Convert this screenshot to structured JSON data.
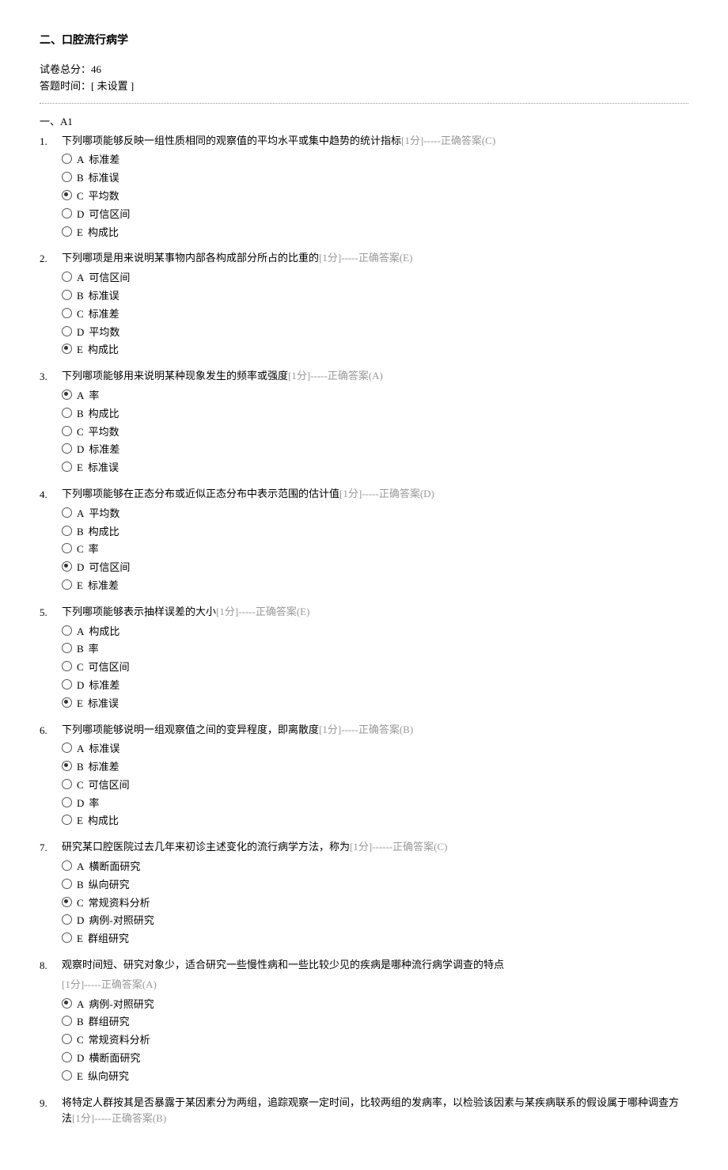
{
  "title": "二、口腔流行病学",
  "meta": {
    "total_label": "试卷总分：",
    "total_value": "46",
    "time_label": "答题时间：",
    "time_value": "[ 未设置 ]"
  },
  "section_label": "一、A1",
  "points_template": "[1分]",
  "answer_prefix": "-----正确答案",
  "questions": [
    {
      "num": "1.",
      "stem": "下列哪项能够反映一组性质相同的观察值的平均水平或集中趋势的统计指标",
      "answer": "(C)",
      "selected": "C",
      "opts": [
        {
          "letter": "A",
          "text": "标准差"
        },
        {
          "letter": "B",
          "text": "标准误"
        },
        {
          "letter": "C",
          "text": "平均数"
        },
        {
          "letter": "D",
          "text": "可信区间"
        },
        {
          "letter": "E",
          "text": "构成比"
        }
      ]
    },
    {
      "num": "2.",
      "stem": "下列哪项是用来说明某事物内部各构成部分所占的比重的",
      "answer": "(E)",
      "selected": "E",
      "opts": [
        {
          "letter": "A",
          "text": "可信区间"
        },
        {
          "letter": "B",
          "text": "标准误"
        },
        {
          "letter": "C",
          "text": "标准差"
        },
        {
          "letter": "D",
          "text": "平均数"
        },
        {
          "letter": "E",
          "text": "构成比"
        }
      ]
    },
    {
      "num": "3.",
      "stem": "下列哪项能够用来说明某种现象发生的频率或强度",
      "answer": "(A)",
      "selected": "A",
      "opts": [
        {
          "letter": "A",
          "text": "率"
        },
        {
          "letter": "B",
          "text": "构成比"
        },
        {
          "letter": "C",
          "text": "平均数"
        },
        {
          "letter": "D",
          "text": "标准差"
        },
        {
          "letter": "E",
          "text": "标准误"
        }
      ]
    },
    {
      "num": "4.",
      "stem": "下列哪项能够在正态分布或近似正态分布中表示范围的估计值",
      "answer": "(D)",
      "selected": "D",
      "opts": [
        {
          "letter": "A",
          "text": "平均数"
        },
        {
          "letter": "B",
          "text": "构成比"
        },
        {
          "letter": "C",
          "text": "率"
        },
        {
          "letter": "D",
          "text": "可信区间"
        },
        {
          "letter": "E",
          "text": "标准差"
        }
      ]
    },
    {
      "num": "5.",
      "stem": "下列哪项能够表示抽样误差的大小",
      "answer": "(E)",
      "selected": "E",
      "opts": [
        {
          "letter": "A",
          "text": "构成比"
        },
        {
          "letter": "B",
          "text": "率"
        },
        {
          "letter": "C",
          "text": "可信区间"
        },
        {
          "letter": "D",
          "text": "标准差"
        },
        {
          "letter": "E",
          "text": "标准误"
        }
      ]
    },
    {
      "num": "6.",
      "stem": "下列哪项能够说明一组观察值之间的变异程度，即离散度",
      "answer": "(B)",
      "selected": "B",
      "opts": [
        {
          "letter": "A",
          "text": "标准误"
        },
        {
          "letter": "B",
          "text": "标准差"
        },
        {
          "letter": "C",
          "text": "可信区间"
        },
        {
          "letter": "D",
          "text": "率"
        },
        {
          "letter": "E",
          "text": "构成比"
        }
      ]
    },
    {
      "num": "7.",
      "stem": "研究某口腔医院过去几年来初诊主述变化的流行病学方法，称为",
      "answer": "(C)",
      "selected": "C",
      "answer_dashes": "------",
      "opts": [
        {
          "letter": "A",
          "text": "横断面研究"
        },
        {
          "letter": "B",
          "text": "纵向研究"
        },
        {
          "letter": "C",
          "text": "常规资料分析"
        },
        {
          "letter": "D",
          "text": "病例-对照研究"
        },
        {
          "letter": "E",
          "text": "群组研究"
        }
      ]
    },
    {
      "num": "8.",
      "stem": "观察时间短、研究对象少，适合研究一些慢性病和一些比较少见的疾病是哪种流行病学调查的特点",
      "answer": "(A)",
      "selected": "A",
      "stem_break": true,
      "opts": [
        {
          "letter": "A",
          "text": "病例-对照研究"
        },
        {
          "letter": "B",
          "text": "群组研究"
        },
        {
          "letter": "C",
          "text": "常规资料分析"
        },
        {
          "letter": "D",
          "text": "横断面研究"
        },
        {
          "letter": "E",
          "text": "纵向研究"
        }
      ]
    },
    {
      "num": "9.",
      "stem": "将特定人群按其是否暴露于某因素分为两组，追踪观察一定时间，比较两组的发病率，以检验该因素与某疾病联系的假设属于哪种调查方法",
      "answer": "(B)",
      "selected": "",
      "opts": []
    }
  ]
}
